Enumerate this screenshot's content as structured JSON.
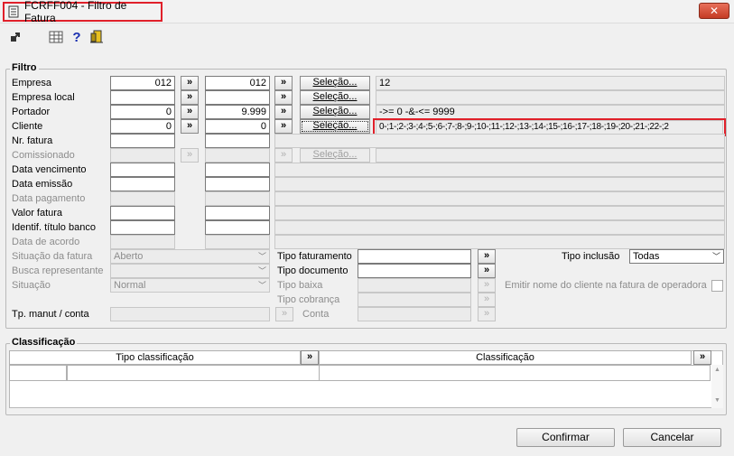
{
  "window": {
    "title": "FCRFF004 - Filtro de Fatura",
    "close_glyph": "✕"
  },
  "toolbar": {
    "icons": [
      "export-icon",
      "table-icon",
      "help-icon",
      "exit-door-icon"
    ]
  },
  "filtro": {
    "legend": "Filtro",
    "labels": {
      "empresa": "Empresa",
      "empresa_local": "Empresa local",
      "portador": "Portador",
      "cliente": "Cliente",
      "nr_fatura": "Nr. fatura",
      "comissionado": "Comissionado",
      "data_vencimento": "Data vencimento",
      "data_emissao": "Data emissão",
      "data_pagamento": "Data pagamento",
      "valor_fatura": "Valor fatura",
      "identif_titulo_banco": "Identif. título banco",
      "data_de_acordo": "Data de acordo",
      "situacao_da_fatura": "Situação da fatura",
      "busca_representante": "Busca representante",
      "situacao": "Situação",
      "tp_manut_conta": "Tp. manut / conta",
      "tipo_faturamento": "Tipo faturamento",
      "tipo_documento": "Tipo documento",
      "tipo_baixa": "Tipo baixa",
      "tipo_cobranca": "Tipo cobrança",
      "conta": "Conta",
      "tipo_inclusao": "Tipo inclusão",
      "emitir_nome": "Emitir nome do cliente na fatura de operadora"
    },
    "values": {
      "empresa_from": "012",
      "empresa_to": "012",
      "portador_from": "0",
      "portador_to": "9.999",
      "cliente_from": "0",
      "cliente_to": "0",
      "situacao_da_fatura": "Aberto",
      "situacao": "Normal",
      "tipo_inclusao": "Todas"
    },
    "arrow_glyph": "»",
    "selecao_label": "Seleção...",
    "info": {
      "empresa": "12",
      "portador": "->= 0 -&-<= 9999",
      "cliente": "0-;1-;2-;3-;4-;5-;6-;7-;8-;9-;10-;11-;12-;13-;14-;15-;16-;17-;18-;19-;20-;21-;22-;2"
    }
  },
  "classificacao": {
    "legend": "Classificação",
    "columns": [
      "Tipo classificação",
      "Classificação"
    ],
    "scroll_up": "▲",
    "scroll_down": "▼"
  },
  "footer": {
    "confirmar": "Confirmar",
    "cancelar": "Cancelar"
  },
  "colors": {
    "highlight": "#e0202a",
    "window_bg": "#f0f0f0"
  }
}
